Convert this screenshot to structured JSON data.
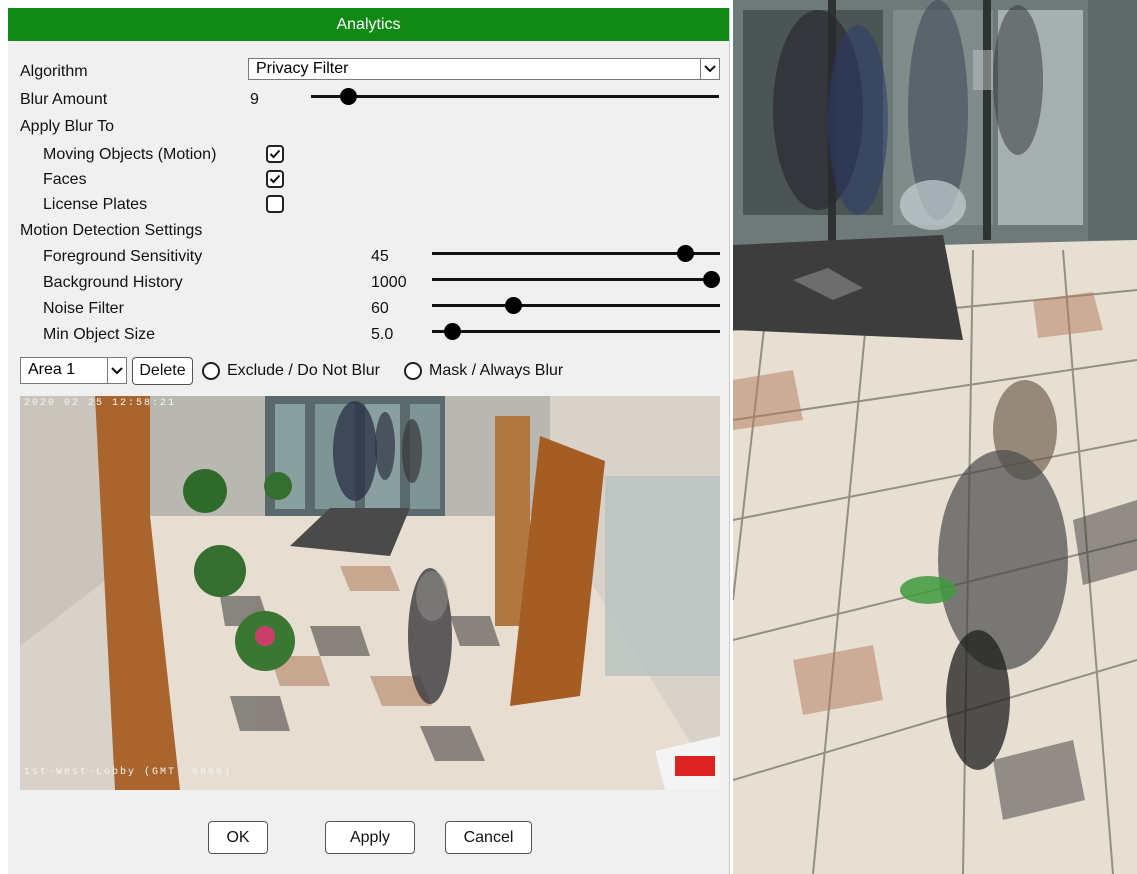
{
  "dialog": {
    "title": "Analytics",
    "algorithm": {
      "label": "Algorithm",
      "value": "Privacy Filter"
    },
    "blur_amount": {
      "label": "Blur Amount",
      "value": "9",
      "level": 0.09
    },
    "apply_blur_to": {
      "label": "Apply Blur To",
      "options": [
        {
          "label": "Moving Objects (Motion)",
          "checked": true
        },
        {
          "label": "Faces",
          "checked": true
        },
        {
          "label": "License Plates",
          "checked": false
        }
      ]
    },
    "motion_detection": {
      "label": "Motion Detection Settings",
      "settings": [
        {
          "label": "Foreground Sensitivity",
          "value": "45",
          "level": 0.88
        },
        {
          "label": "Background History",
          "value": "1000",
          "level": 1.0
        },
        {
          "label": "Noise Filter",
          "value": "60",
          "level": 0.28
        },
        {
          "label": "Min Object Size",
          "value": "5.0",
          "level": 0.07
        }
      ]
    },
    "area": {
      "select_value": "Area 1",
      "delete_label": "Delete",
      "exclude_label": "Exclude / Do Not Blur",
      "mask_label": "Mask / Always Blur"
    },
    "preview": {
      "timestamp": "2020 02 25 12:58:21",
      "camera_label": "1st-West-Lobby (GMT -0800)"
    },
    "buttons": {
      "ok": "OK",
      "apply": "Apply",
      "cancel": "Cancel"
    }
  },
  "colors": {
    "title_bar": "#118a15",
    "dialog_bg": "#f0f0f0"
  }
}
